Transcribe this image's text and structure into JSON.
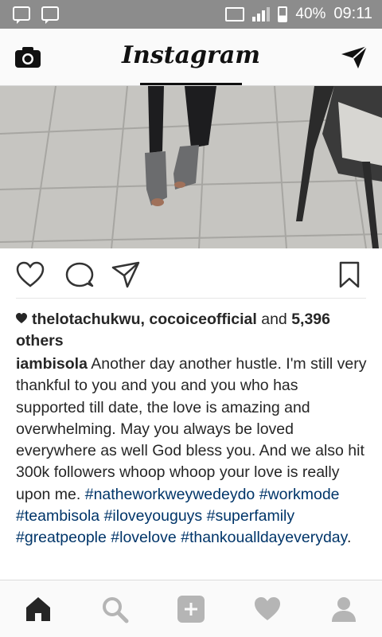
{
  "status_bar": {
    "battery": "40%",
    "time": "09:11"
  },
  "header": {
    "logo": "Instagram",
    "camera_icon": "camera-icon",
    "direct_icon": "paper-plane-icon"
  },
  "post": {
    "likes": {
      "prefix_users": "thelotachukwu, cocoiceofficial",
      "connector": "and",
      "count_text": "5,396 others"
    },
    "caption": {
      "username": "iambisola",
      "text": "Another day another hustle. I'm still very thankful to you and you and you who has supported till date, the love is amazing and overwhelming. May you always be loved everywhere as well God bless you. And we also hit 300k followers whoop whoop your love is really upon me.",
      "hashtags": [
        "#natheworkweywedeydo",
        "#workmode",
        "#teambisola",
        "#iloveyouguys",
        "#superfamily",
        "#greatpeople",
        "#lovelove",
        "#thankoualldayeveryday"
      ],
      "ending": "."
    }
  },
  "colors": {
    "hashtag": "#003569",
    "status_bar": "#8c8c8c",
    "text": "#262626"
  },
  "icons": {
    "actions": [
      "heart-icon",
      "comment-icon",
      "share-icon",
      "bookmark-icon"
    ],
    "nav": [
      "home-icon",
      "search-icon",
      "add-icon",
      "activity-heart-icon",
      "profile-icon"
    ]
  }
}
